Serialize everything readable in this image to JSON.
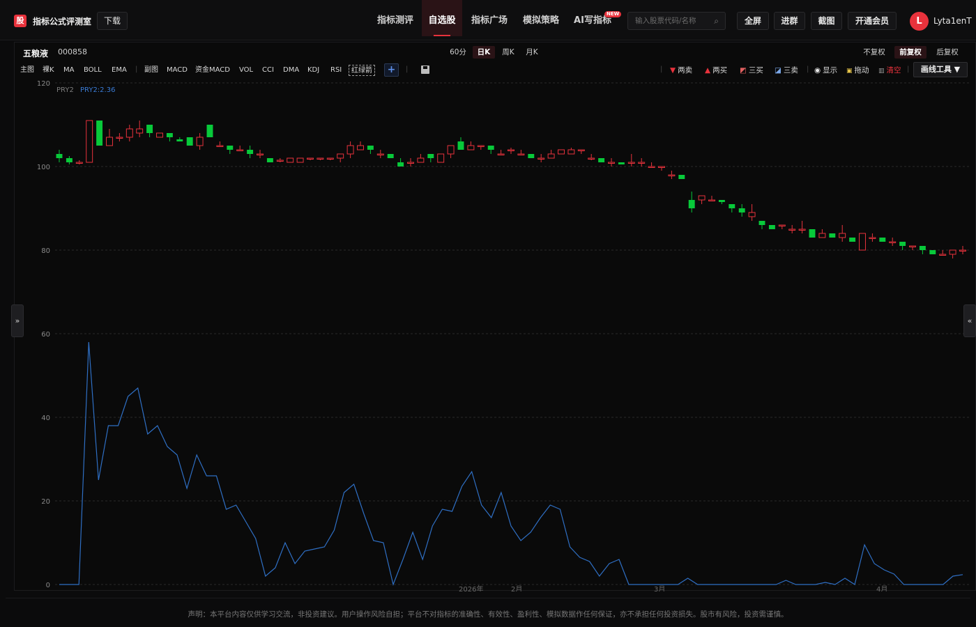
{
  "brand": {
    "logo": "股",
    "name": "指标公式评测室",
    "download": "下载"
  },
  "nav": [
    {
      "label": "指标测评",
      "active": false
    },
    {
      "label": "自选股",
      "active": true
    },
    {
      "label": "指标广场",
      "active": false
    },
    {
      "label": "模拟策略",
      "active": false
    },
    {
      "label": "AI写指标",
      "active": false
    }
  ],
  "new_badge": "NEW",
  "search": {
    "placeholder": "输入股票代码/名称"
  },
  "header_buttons": [
    "全屏",
    "进群",
    "截图",
    "开通会员"
  ],
  "user": {
    "initial": "L",
    "name": "Lyta1enT"
  },
  "stock": {
    "name": "五粮液",
    "code": "000858"
  },
  "periods": [
    {
      "label": "60分",
      "active": false
    },
    {
      "label": "日K",
      "active": true
    },
    {
      "label": "周K",
      "active": false
    },
    {
      "label": "月K",
      "active": false
    }
  ],
  "adjust": [
    {
      "label": "不复权",
      "active": false
    },
    {
      "label": "前复权",
      "active": true
    },
    {
      "label": "后复权",
      "active": false
    }
  ],
  "indicators_main": [
    "主图",
    "裸K",
    "MA",
    "BOLL",
    "EMA"
  ],
  "indicators_sub": [
    "副图",
    "MACD",
    "资金MACD",
    "VOL",
    "CCI",
    "DMA",
    "KDJ",
    "RSI",
    "红绿箭"
  ],
  "tools": [
    {
      "label": "两卖",
      "glyph": "▼",
      "color": "#e8323c"
    },
    {
      "label": "两买",
      "glyph": "▲",
      "color": "#e8323c"
    },
    {
      "label": "三买",
      "glyph": "◩",
      "color": "#e8e8e8"
    },
    {
      "label": "三卖",
      "glyph": "◪",
      "color": "#e8e8e8"
    },
    {
      "label": "显示",
      "glyph": "◉",
      "color": "#e8e8e8"
    },
    {
      "label": "拖动",
      "glyph": "🔒",
      "color": "#e8c64a"
    },
    {
      "label": "清空",
      "glyph": "🗑",
      "color": "#e8323c"
    }
  ],
  "draw_tool": "画线工具 ▼",
  "side_tabs": {
    "left": "»",
    "right": "«"
  },
  "colors": {
    "up": "#e8323c",
    "down": "#08c93a",
    "line": "#2f6fc4",
    "accent": "#e8323c"
  },
  "chart_data": {
    "type": "candlestick",
    "y_ticks": [
      0,
      20,
      40,
      60,
      80,
      100,
      120
    ],
    "ylim": [
      0,
      120
    ],
    "indicator_legend": [
      "PRY2",
      "PRY2:2.36"
    ],
    "x_labels": [
      "2026年",
      "2月",
      "3月",
      "4月"
    ],
    "candles": [
      [
        103,
        102,
        104,
        101
      ],
      [
        102,
        101,
        102.5,
        100.5
      ],
      [
        101,
        101,
        101.5,
        100.5
      ],
      [
        101,
        111,
        111,
        101
      ],
      [
        111,
        105,
        111,
        105
      ],
      [
        105,
        107,
        109,
        105
      ],
      [
        107,
        107,
        108,
        106
      ],
      [
        107,
        109,
        110,
        106
      ],
      [
        108,
        109,
        111,
        107
      ],
      [
        110,
        108,
        110,
        107
      ],
      [
        107,
        108,
        108,
        107
      ],
      [
        108,
        107,
        108,
        106
      ],
      [
        106.5,
        106,
        107,
        106
      ],
      [
        107,
        105,
        107,
        105
      ],
      [
        105,
        107,
        108,
        104
      ],
      [
        110,
        107,
        110,
        107
      ],
      [
        105,
        105,
        106,
        105
      ],
      [
        105,
        104,
        105,
        103
      ],
      [
        104,
        104,
        105,
        104
      ],
      [
        104,
        103,
        105,
        102
      ],
      [
        103,
        103,
        104,
        102
      ],
      [
        102,
        101,
        102,
        101
      ],
      [
        101.5,
        101.5,
        102,
        101
      ],
      [
        101,
        102,
        102,
        101
      ],
      [
        101,
        102,
        102,
        101
      ],
      [
        102,
        102,
        102,
        101.5
      ],
      [
        102,
        102,
        102,
        101.5
      ],
      [
        102,
        102,
        102,
        101.5
      ],
      [
        102,
        103,
        103,
        101
      ],
      [
        103,
        105,
        106,
        102
      ],
      [
        104,
        105,
        106,
        104
      ],
      [
        105,
        104,
        105,
        103
      ],
      [
        103,
        103,
        104,
        102
      ],
      [
        103,
        102,
        103,
        102
      ],
      [
        101,
        100,
        102,
        100
      ],
      [
        101,
        101,
        102,
        100
      ],
      [
        101,
        102,
        103,
        101
      ],
      [
        103,
        102,
        103,
        101
      ],
      [
        101,
        103,
        103,
        101
      ],
      [
        103,
        105,
        105,
        102
      ],
      [
        106,
        104,
        107,
        104
      ],
      [
        104,
        105,
        106,
        104
      ],
      [
        105,
        105,
        105,
        104
      ],
      [
        105,
        104,
        105,
        103
      ],
      [
        103,
        103,
        104,
        103
      ],
      [
        104,
        104,
        104.5,
        103
      ],
      [
        103,
        103,
        104,
        103
      ],
      [
        103,
        102,
        103,
        102
      ],
      [
        102,
        102,
        103,
        101
      ],
      [
        102,
        103,
        104,
        102
      ],
      [
        103,
        104,
        104,
        103
      ],
      [
        103,
        104,
        104.5,
        103
      ],
      [
        104,
        104,
        104,
        103
      ],
      [
        102,
        102,
        103,
        101.5
      ],
      [
        102,
        101,
        102,
        101
      ],
      [
        101,
        101,
        102,
        100
      ],
      [
        101,
        100.5,
        101,
        100.5
      ],
      [
        101,
        101,
        103,
        100
      ],
      [
        101,
        101,
        102,
        100
      ],
      [
        100,
        100,
        101,
        100
      ],
      [
        100,
        100,
        100,
        99
      ],
      [
        98,
        98,
        99,
        97
      ],
      [
        98,
        97,
        98,
        97
      ],
      [
        92,
        90,
        94,
        89
      ],
      [
        92,
        93,
        93,
        91
      ],
      [
        92,
        92,
        93,
        92
      ],
      [
        92,
        91.5,
        92,
        91
      ],
      [
        91,
        90,
        91,
        89
      ],
      [
        90,
        89,
        91,
        88
      ],
      [
        88,
        89,
        91,
        87
      ],
      [
        87,
        86,
        87,
        85
      ],
      [
        86,
        85,
        86,
        85
      ],
      [
        86,
        86,
        86,
        85
      ],
      [
        85,
        85,
        86,
        84
      ],
      [
        85,
        85,
        87,
        84
      ],
      [
        85,
        83,
        85,
        83
      ],
      [
        83,
        84,
        85,
        83
      ],
      [
        84,
        83,
        84,
        83
      ],
      [
        83,
        84,
        86,
        82
      ],
      [
        83,
        82,
        83,
        82
      ],
      [
        80,
        84,
        84,
        80
      ],
      [
        83,
        83,
        84,
        82
      ],
      [
        83,
        82,
        83,
        82
      ],
      [
        82,
        82,
        83,
        81
      ],
      [
        82,
        81,
        82,
        80
      ],
      [
        81,
        81,
        81,
        80
      ],
      [
        81,
        80,
        81,
        79
      ],
      [
        80,
        79,
        80,
        79
      ],
      [
        79,
        79,
        80,
        79
      ],
      [
        79,
        80,
        80,
        78
      ],
      [
        80,
        80,
        81,
        79
      ]
    ],
    "indicator_series": {
      "name": "PRY2",
      "values": [
        0,
        0,
        0,
        58,
        25,
        38,
        38,
        45,
        47,
        36,
        38,
        33,
        31,
        23,
        31,
        26,
        26,
        18,
        19,
        15,
        11,
        2,
        4,
        10,
        5,
        8,
        8.5,
        9,
        13,
        22,
        24,
        17,
        10.5,
        10,
        0,
        6,
        12.5,
        6,
        14,
        18,
        17.5,
        23.5,
        27,
        19,
        16,
        22,
        14,
        10.5,
        12.5,
        16,
        19,
        18,
        9,
        6.5,
        5.5,
        2,
        5,
        6,
        0,
        0,
        0,
        0,
        0,
        0,
        1.5,
        0,
        0,
        0,
        0,
        0,
        0,
        0,
        0,
        0,
        1,
        0,
        0,
        0,
        0.5,
        0,
        1.5,
        0,
        9.5,
        5,
        3.5,
        2.5,
        0,
        0,
        0,
        0,
        0,
        2,
        2.36
      ]
    }
  },
  "disclaimer": "声明：本平台内容仅供学习交流，非投资建议。用户操作风险自担；平台不对指标的准确性、有效性、盈利性、模拟数据作任何保证，亦不承担任何投资损失。股市有风险，投资需谨慎。"
}
